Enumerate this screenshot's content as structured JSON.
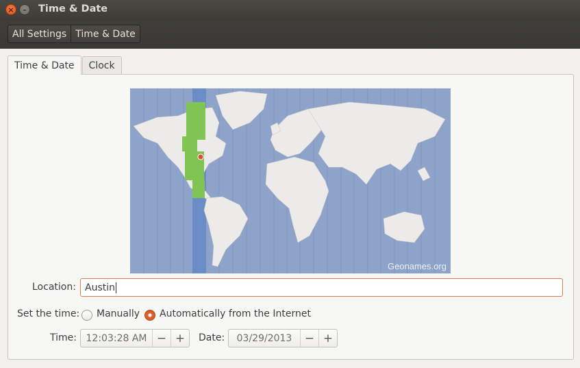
{
  "window": {
    "title": "Time & Date"
  },
  "breadcrumbs": [
    "All Settings",
    "Time & Date"
  ],
  "tabs": [
    {
      "label": "Time & Date",
      "active": true
    },
    {
      "label": "Clock",
      "active": false
    }
  ],
  "map": {
    "attribution": "Geonames.org",
    "selected_city": "Austin",
    "highlight_color": "#82c454",
    "ocean_color": "#8da3c9",
    "land_color": "#ecebea",
    "pin_color": "#e04a3b"
  },
  "location": {
    "label": "Location:",
    "value": "Austin"
  },
  "set_time": {
    "label": "Set the time:",
    "options": [
      {
        "label": "Manually",
        "checked": false
      },
      {
        "label": "Automatically from the Internet",
        "checked": true
      }
    ]
  },
  "time": {
    "label": "Time:",
    "value": "12:03:28 AM",
    "minus": "−",
    "plus": "+"
  },
  "date": {
    "label": "Date:",
    "value": "03/29/2013",
    "minus": "−",
    "plus": "+"
  },
  "colors": {
    "accent": "#dd4814",
    "titlebar": "#3c3b37"
  }
}
